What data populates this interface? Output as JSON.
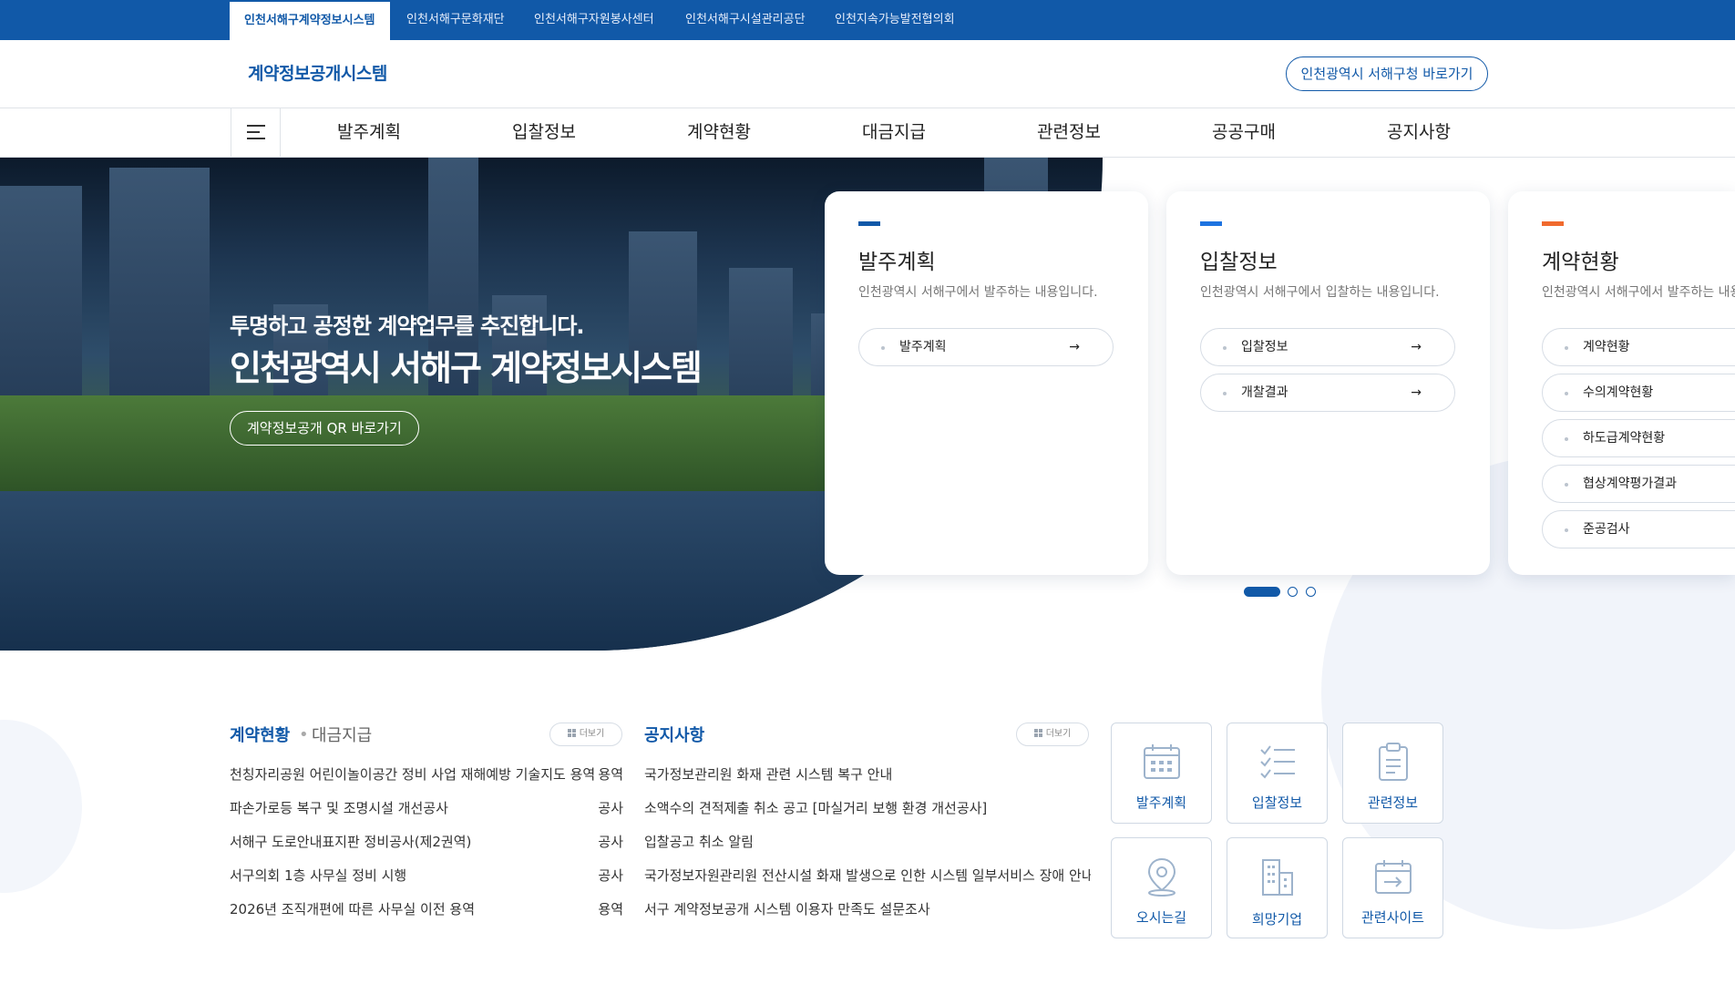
{
  "topbar": {
    "tabs": [
      {
        "label": "인천서해구계약정보시스템",
        "active": true
      },
      {
        "label": "인천서해구문화재단"
      },
      {
        "label": "인천서해구자원봉사센터"
      },
      {
        "label": "인천서해구시설관리공단"
      },
      {
        "label": "인천지속가능발전협의회"
      }
    ]
  },
  "header": {
    "logo": "계약정보공개시스템",
    "shortcut_button": "인천광역시 서해구청 바로가기"
  },
  "gnb": {
    "items": [
      "발주계획",
      "입찰정보",
      "계약현황",
      "대금지급",
      "관련정보",
      "공공구매",
      "공지사항"
    ]
  },
  "hero": {
    "subtitle": "투명하고 공정한 계약업무를 추진합니다.",
    "title": "인천광역시 서해구 계약정보시스템",
    "qr_button": "계약정보공개 QR 바로가기"
  },
  "cards": [
    {
      "title": "발주계획",
      "desc": "인천광역시 서해구에서 발주하는 내용입니다.",
      "accent": "#1159a8",
      "links": [
        "발주계획"
      ]
    },
    {
      "title": "입찰정보",
      "desc": "인천광역시 서해구에서 입찰하는 내용입니다.",
      "accent": "#1e73e0",
      "links": [
        "입찰정보",
        "개찰결과"
      ]
    },
    {
      "title": "계약현황",
      "desc": "인천광역시 서해구에서 발주하는 내용입니다.",
      "accent": "#f06a2e",
      "links": [
        "계약현황",
        "수의계약현황",
        "하도급계약현황",
        "협상계약평가결과",
        "준공검사"
      ]
    }
  ],
  "arrow_glyph": "→",
  "contracts": {
    "title": "계약현황",
    "separator": "•",
    "subtitle": "대금지급",
    "more": "더보기",
    "items": [
      {
        "title": "천칭자리공원 어린이놀이공간 정비 사업 재해예방 기술지도 용역",
        "type": "용역"
      },
      {
        "title": "파손가로등 복구 및 조명시설 개선공사",
        "type": "공사"
      },
      {
        "title": "서해구 도로안내표지판 정비공사(제2권역)",
        "type": "공사"
      },
      {
        "title": "서구의회 1층 사무실 정비 시행",
        "type": "공사"
      },
      {
        "title": "2026년 조직개편에 따른 사무실 이전 용역",
        "type": "용역"
      }
    ]
  },
  "notices": {
    "title": "공지사항",
    "more": "더보기",
    "items": [
      "국가정보관리원 화재 관련 시스템 복구 안내",
      "소액수의 견적제출 취소 공고 [마실거리 보행 환경 개선공사]",
      "입찰공고 취소 알림",
      "국가정보자원관리원 전산시설 화재 발생으로 인한 시스템 일부서비스 장애 안내",
      "서구 계약정보공개 시스템 이용자 만족도 설문조사"
    ]
  },
  "quick_links": [
    {
      "label": "발주계획",
      "icon": "calendar-icon"
    },
    {
      "label": "입찰정보",
      "icon": "checklist-icon"
    },
    {
      "label": "관련정보",
      "icon": "clipboard-icon"
    },
    {
      "label": "오시는길",
      "icon": "map-pin-icon"
    },
    {
      "label": "희망기업",
      "icon": "building-icon"
    },
    {
      "label": "관련사이트",
      "icon": "external-link-icon"
    }
  ],
  "colors": {
    "brand": "#1159a8",
    "accent_blue": "#1e73e0",
    "accent_orange": "#f06a2e"
  }
}
